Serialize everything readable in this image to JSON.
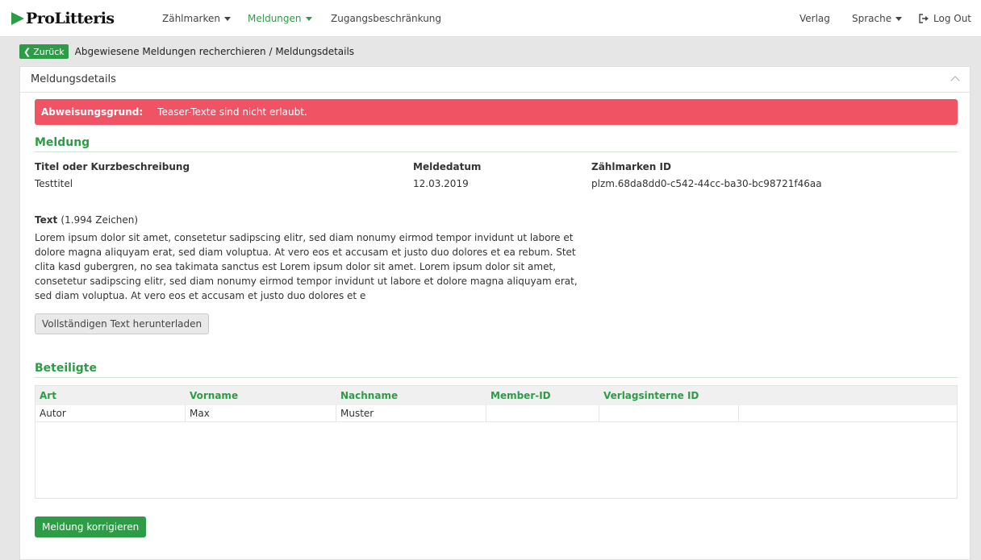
{
  "brand": {
    "name": "ProLitteris",
    "color": "#2e9b47"
  },
  "nav": {
    "items": [
      {
        "label": "Zählmarken",
        "dropdown": true
      },
      {
        "label": "Meldungen",
        "dropdown": true,
        "active": true
      },
      {
        "label": "Zugangsbeschränkung",
        "dropdown": false
      }
    ],
    "right": {
      "verlag": "Verlag",
      "sprache": "Sprache",
      "logout": "Log Out"
    }
  },
  "breadcrumb": {
    "back": "Zurück",
    "path": "Abgewiesene Meldungen recherchieren / Meldungsdetails"
  },
  "panel": {
    "title": "Meldungsdetails",
    "alert": {
      "label": "Abweisungsgrund:",
      "message": "Teaser-Texte sind nicht erlaubt.",
      "color": "#ef5364"
    },
    "meldung": {
      "heading": "Meldung",
      "titel_label": "Titel oder Kurzbeschreibung",
      "titel_value": "Testtitel",
      "datum_label": "Meldedatum",
      "datum_value": "12.03.2019",
      "zid_label": "Zählmarken ID",
      "zid_value": "plzm.68da8dd0-c542-44cc-ba30-bc98721f46aa",
      "text_label": "Text",
      "text_count": "(1.994 Zeichen)",
      "text_body": "Lorem ipsum dolor sit amet, consetetur sadipscing elitr, sed diam nonumy eirmod tempor invidunt ut labore et dolore magna aliquyam erat, sed diam voluptua. At vero eos et accusam et justo duo dolores et ea rebum. Stet clita kasd gubergren, no sea takimata sanctus est Lorem ipsum dolor sit amet. Lorem ipsum dolor sit amet, consetetur sadipscing elitr, sed diam nonumy eirmod tempor invidunt ut labore et dolore magna aliquyam erat, sed diam voluptua. At vero eos et accusam et justo duo dolores et e",
      "download_button": "Vollständigen Text herunterladen"
    },
    "beteiligte": {
      "heading": "Beteiligte",
      "columns": [
        "Art",
        "Vorname",
        "Nachname",
        "Member-ID",
        "Verlagsinterne ID",
        ""
      ],
      "rows": [
        [
          "Autor",
          "Max",
          "Muster",
          "",
          "",
          ""
        ]
      ]
    },
    "submit_button": "Meldung korrigieren"
  }
}
